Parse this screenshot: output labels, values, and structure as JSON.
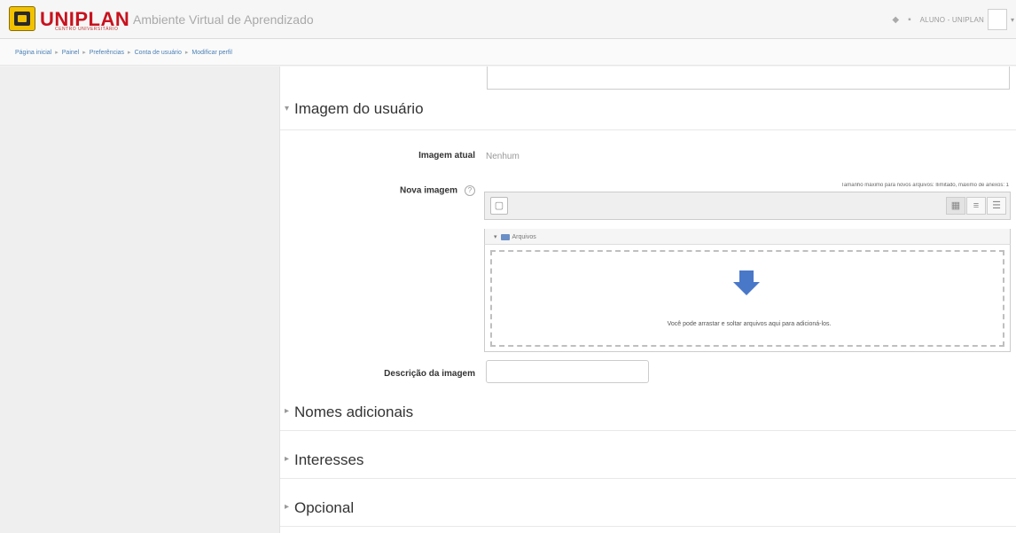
{
  "header": {
    "brand": "UNIPLAN",
    "brand_subtitle": "CENTRO UNIVERSITÁRIO",
    "app_name": "Ambiente Virtual de Aprendizado",
    "user_name": "ALUNO - UNIPLAN"
  },
  "breadcrumb": [
    "Página inicial",
    "Painel",
    "Preferências",
    "Conta de usuário",
    "Modificar perfil"
  ],
  "sections": {
    "user_image": {
      "title": "Imagem do usuário",
      "expanded": true
    },
    "additional_names": {
      "title": "Nomes adicionais",
      "expanded": false
    },
    "interests": {
      "title": "Interesses",
      "expanded": false
    },
    "optional": {
      "title": "Opcional",
      "expanded": false
    }
  },
  "form": {
    "current_image_label": "Imagem atual",
    "current_image_value": "Nenhum",
    "new_image_label": "Nova imagem",
    "file_limits": "Tamanho máximo para novos arquivos: Ilimitado, máximo de anexos: 1",
    "files_folder": "Arquivos",
    "drop_message": "Você pode arrastar e soltar arquivos aqui para adicioná-los.",
    "image_description_label": "Descrição da imagem",
    "image_description_value": ""
  },
  "icons": {
    "expanded_toggle": "▾",
    "collapsed_toggle": "▸",
    "help": "?",
    "add_file": "▢",
    "view_icons": "▦",
    "view_list": "≡",
    "view_tree": "☰"
  },
  "colors": {
    "brand_red": "#c8121e",
    "brand_yellow": "#f2c200",
    "link_blue": "#4a7fb5",
    "drop_arrow": "#4a78c9"
  }
}
